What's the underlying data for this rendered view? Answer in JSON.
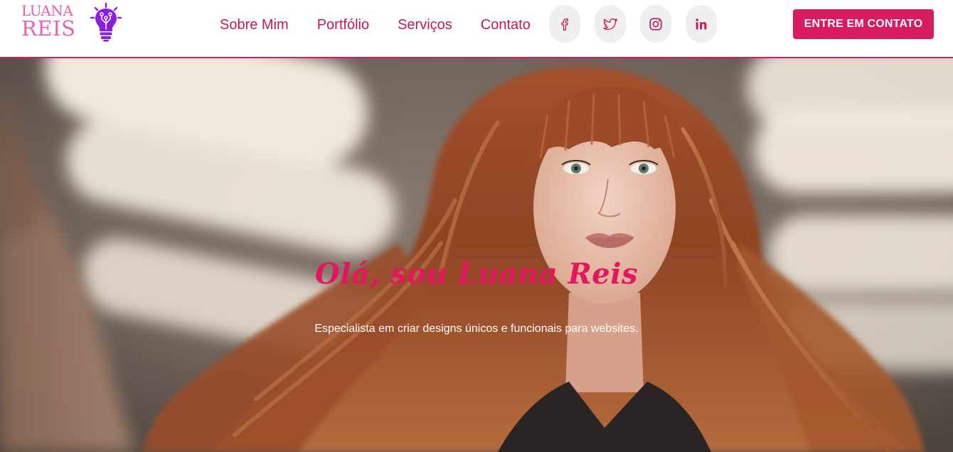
{
  "brand": {
    "logo_line1": "LUANA",
    "logo_line2": "REIS",
    "logo_color": "#ea5fb0",
    "bulb_color": "#8a1fe0"
  },
  "nav": {
    "items": [
      {
        "label": "Sobre Mim"
      },
      {
        "label": "Portfólio"
      },
      {
        "label": "Serviços"
      },
      {
        "label": "Contato"
      }
    ]
  },
  "socials": [
    {
      "icon": "facebook-icon"
    },
    {
      "icon": "twitter-icon"
    },
    {
      "icon": "instagram-icon"
    },
    {
      "icon": "linkedin-icon"
    }
  ],
  "cta": {
    "label": "ENTRE EM CONTATO"
  },
  "hero": {
    "title": "Olá, sou Luana Reis",
    "subtitle": "Especialista em criar designs únicos e funcionais para websites."
  },
  "colors": {
    "accent": "#d81b60",
    "nav_text": "#c2185b",
    "hero_title": "#e4165f",
    "social_bg": "#efefef"
  }
}
